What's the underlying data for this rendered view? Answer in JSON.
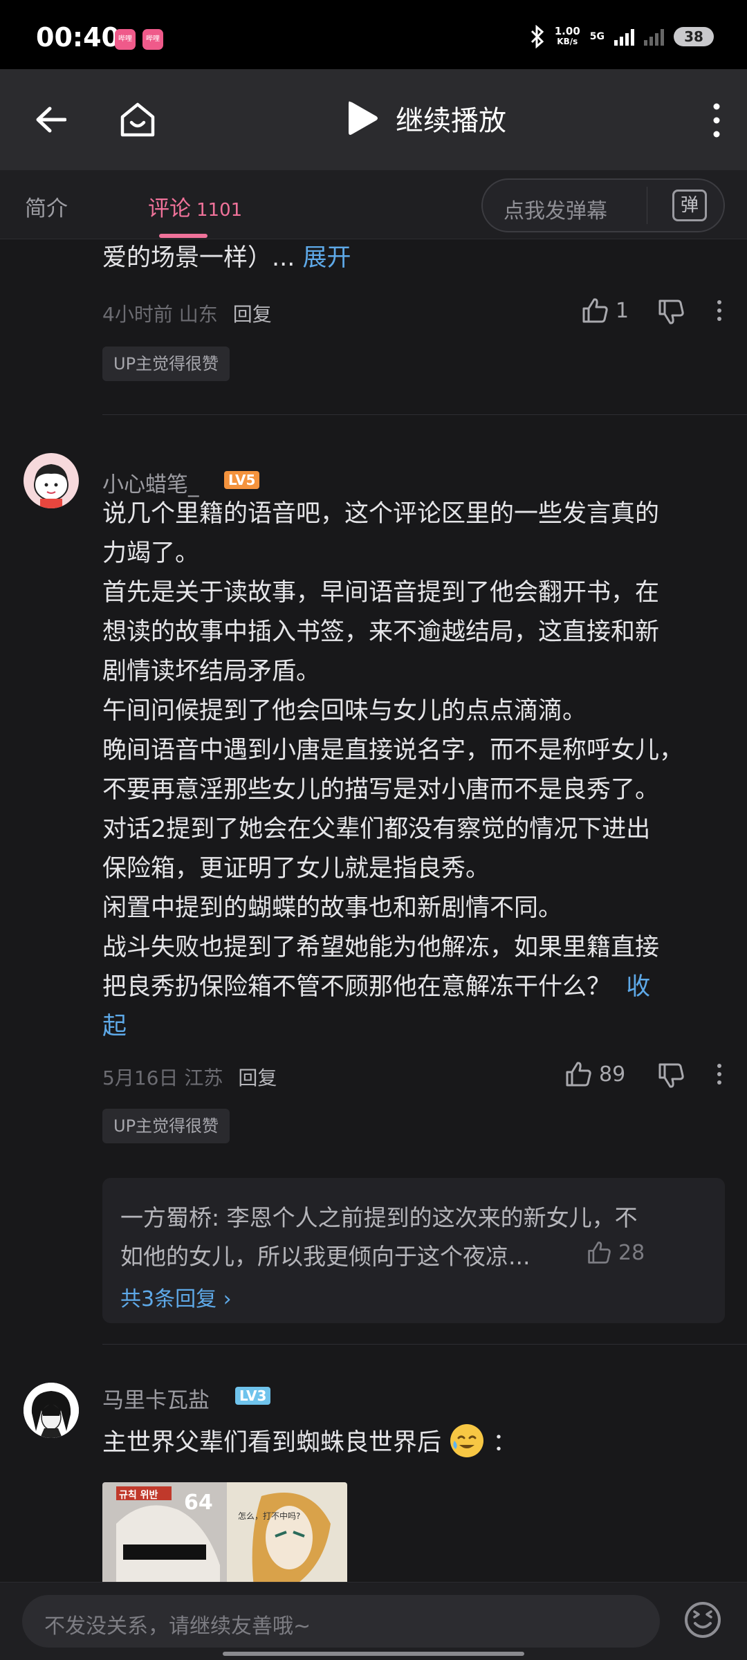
{
  "status_bar": {
    "time": "00:40",
    "app_icon_1": "哔哩",
    "app_icon_2": "哔哩",
    "net_speed": "1.00",
    "net_unit": "KB/s",
    "network": "5G",
    "battery": "38"
  },
  "topbar": {
    "play_label": "继续播放"
  },
  "tabs": {
    "intro": "简介",
    "comments": "评论",
    "comments_count": "1101",
    "danmaku_placeholder": "点我发弹幕",
    "danmaku_icon_label": "弹"
  },
  "comment_prev": {
    "tail_text": "爱的场景一样）...",
    "expand": "展开",
    "time_location": "4小时前 山东",
    "reply": "回复",
    "likes": "1",
    "up_badge": "UP主觉得很赞"
  },
  "comment_main": {
    "username": "小心蜡笔_",
    "level": "LV5",
    "lines": [
      "说几个里籍的语音吧，这个评论区里的一些发言真的",
      "力竭了。",
      "首先是关于读故事，早间语音提到了他会翻开书，在",
      "想读的故事中插入书签，来不逾越结局，这直接和新",
      "剧情读坏结局矛盾。",
      "午间问候提到了他会回味与女儿的点点滴滴。",
      "晚间语音中遇到小唐是直接说名字，而不是称呼女儿，",
      "不要再意淫那些女儿的描写是对小唐而不是良秀了。",
      "对话2提到了她会在父辈们都没有察觉的情况下进出",
      "保险箱，更证明了女儿就是指良秀。",
      "闲置中提到的蝴蝶的故事也和新剧情不同。",
      "战斗失败也提到了希望她能为他解冻，如果里籍直接",
      "把良秀扔保险箱不管不顾那他在意解冻干什么？"
    ],
    "collapse_1": "收",
    "collapse_2": "起",
    "time_location": "5月16日 江苏",
    "reply": "回复",
    "likes": "89",
    "up_badge": "UP主觉得很赞",
    "sub_reply": {
      "line1": "一方蜀桥: 李恩个人之前提到的这次来的新女儿，不",
      "line2": "如他的女儿，所以我更倾向于这个夜凉...",
      "likes": "28",
      "more": "共3条回复 ›"
    }
  },
  "comment_next": {
    "username": "马里卡瓦盐",
    "level": "LV3",
    "text": "主世界父辈们看到蜘蛛良世界后",
    "text_suffix": "：",
    "image_caption_1": "규칙 위반",
    "image_caption_2": "64",
    "image_caption_3": "怎么，打不中吗?"
  },
  "bottom": {
    "input_placeholder": "不发没关系，请继续友善哦~"
  },
  "colors": {
    "accent_pink": "#f0729a",
    "link_blue": "#5ea9e8",
    "lv5_orange": "#f4933d",
    "lv3_blue": "#6fc3ec"
  }
}
